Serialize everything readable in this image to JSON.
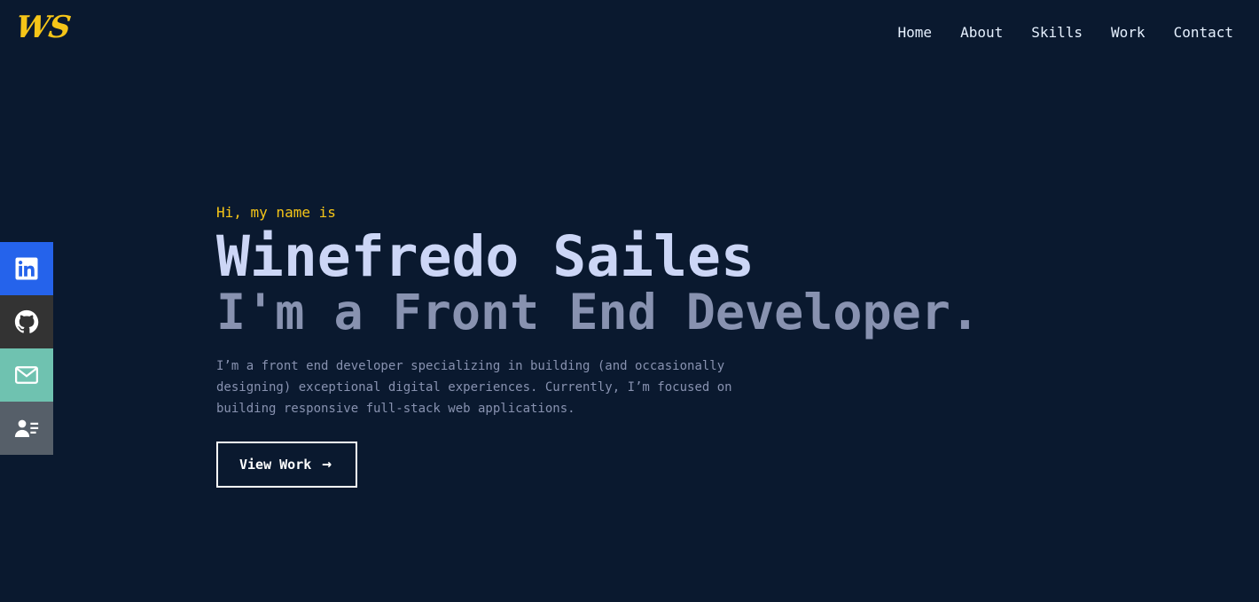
{
  "logo": {
    "text": "WS",
    "color": "#f5c518"
  },
  "nav": {
    "items": [
      {
        "label": "Home"
      },
      {
        "label": "About"
      },
      {
        "label": "Skills"
      },
      {
        "label": "Work"
      },
      {
        "label": "Contact"
      }
    ]
  },
  "social": [
    {
      "icon": "linkedin-icon",
      "color": "#2563eb"
    },
    {
      "icon": "github-icon",
      "color": "#333333"
    },
    {
      "icon": "mail-icon",
      "color": "#6fc2b0"
    },
    {
      "icon": "resume-icon",
      "color": "#565f69"
    }
  ],
  "hero": {
    "greeting": "Hi, my name is",
    "name": "Winefredo Sailes",
    "role": "I'm a Front End Developer.",
    "description": "I’m a front end developer specializing in building (and occasionally designing) exceptional digital experiences. Currently, I’m focused on building responsive full-stack web applications.",
    "cta_label": "View Work",
    "cta_icon": "arrow-right-icon"
  },
  "colors": {
    "background": "#0a192f",
    "accent": "#f5c518",
    "heading": "#ccd6f6",
    "muted": "#8892b0"
  }
}
